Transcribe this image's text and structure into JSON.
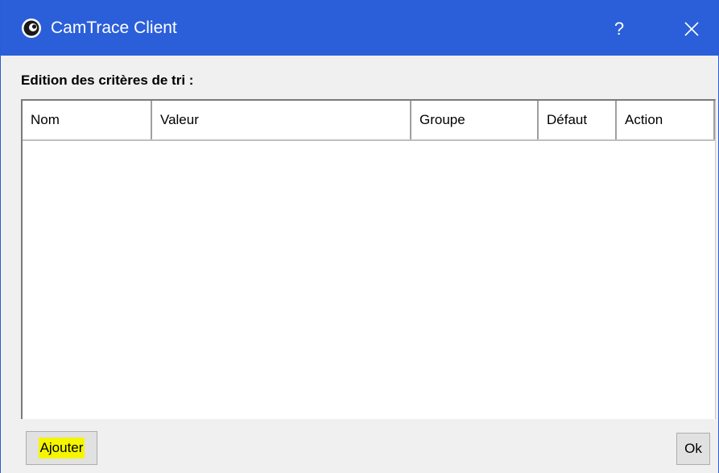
{
  "window": {
    "title": "CamTrace Client",
    "help_label": "?",
    "accent_color": "#2b5fd9",
    "app_icon": "camtrace-eye-icon",
    "close_icon": "close-icon"
  },
  "dialog": {
    "section_title": "Edition des critères de tri :",
    "table": {
      "columns": [
        "Nom",
        "Valeur",
        "Groupe",
        "Défaut",
        "Action"
      ],
      "rows": []
    },
    "buttons": {
      "add_label": "Ajouter",
      "ok_label": "Ok"
    },
    "highlight_color": "#f5f500"
  }
}
